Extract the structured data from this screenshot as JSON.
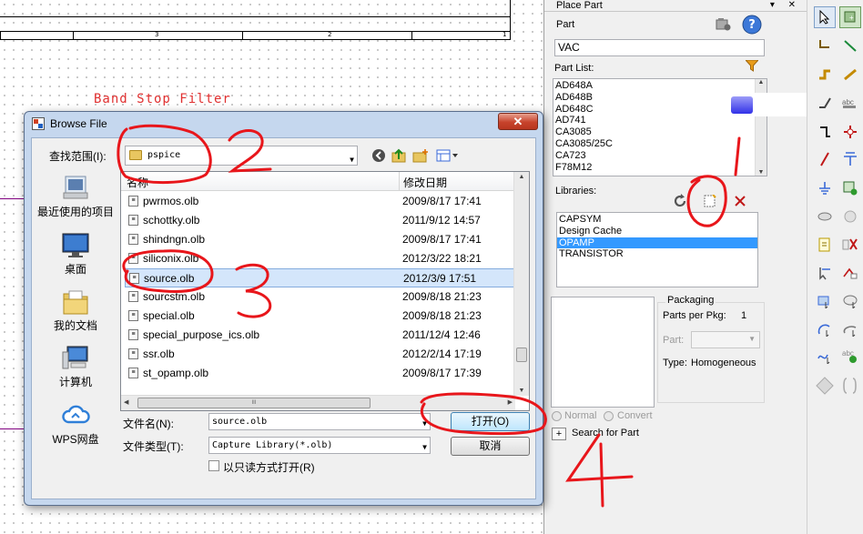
{
  "schematic": {
    "title_text": "Band Stop Filter",
    "ruler_numbers": [
      "3",
      "2",
      "1"
    ]
  },
  "place_part": {
    "window_title": "Place Part",
    "part_label": "Part",
    "part_value": "VAC",
    "part_list_label": "Part List:",
    "part_list": [
      "AD648A",
      "AD648B",
      "AD648C",
      "AD741",
      "CA3085",
      "CA3085/25C",
      "CA723",
      "F78M12"
    ],
    "libraries_label": "Libraries:",
    "libraries": [
      "CAPSYM",
      "Design Cache",
      "OPAMP",
      "TRANSISTOR"
    ],
    "selected_library": "OPAMP",
    "packaging_label": "Packaging",
    "parts_per_pkg_label": "Parts per Pkg:",
    "parts_per_pkg_value": "1",
    "part_label2": "Part:",
    "type_label": "Type:",
    "type_value": "Homogeneous",
    "normal_label": "Normal",
    "convert_label": "Convert",
    "search_label": "Search for Part",
    "expand_symbol": "+"
  },
  "dialog": {
    "title": "Browse File",
    "close_symbol": "✕",
    "look_in_label": "查找范围(I):",
    "look_in_value": "pspice",
    "places": [
      "最近使用的项目",
      "桌面",
      "我的文档",
      "计算机",
      "WPS网盘"
    ],
    "columns": [
      "名称",
      "修改日期"
    ],
    "files": [
      {
        "name": "pwrmos.olb",
        "date": "2009/8/17 17:41"
      },
      {
        "name": "schottky.olb",
        "date": "2011/9/12 14:57"
      },
      {
        "name": "shindngn.olb",
        "date": "2009/8/17 17:41"
      },
      {
        "name": "siliconix.olb",
        "date": "2012/3/22 18:21"
      },
      {
        "name": "source.olb",
        "date": "2012/3/9 17:51"
      },
      {
        "name": "sourcstm.olb",
        "date": "2009/8/18 21:23"
      },
      {
        "name": "special.olb",
        "date": "2009/8/18 21:23"
      },
      {
        "name": "special_purpose_ics.olb",
        "date": "2011/12/4 12:46"
      },
      {
        "name": "ssr.olb",
        "date": "2012/2/14 17:19"
      },
      {
        "name": "st_opamp.olb",
        "date": "2009/8/17 17:39"
      }
    ],
    "selected_file": "source.olb",
    "filename_label": "文件名(N):",
    "filename_value": "source.olb",
    "filetype_label": "文件类型(T):",
    "filetype_value": "Capture Library(*.olb)",
    "readonly_label": "以只读方式打开(R)",
    "open_button": "打开(O)",
    "cancel_button": "取消",
    "hscroll_grip": "III"
  },
  "annotations": {
    "step1": "1",
    "step2": "2",
    "step3": "3",
    "step4": "4",
    "color": "#e8161b"
  }
}
